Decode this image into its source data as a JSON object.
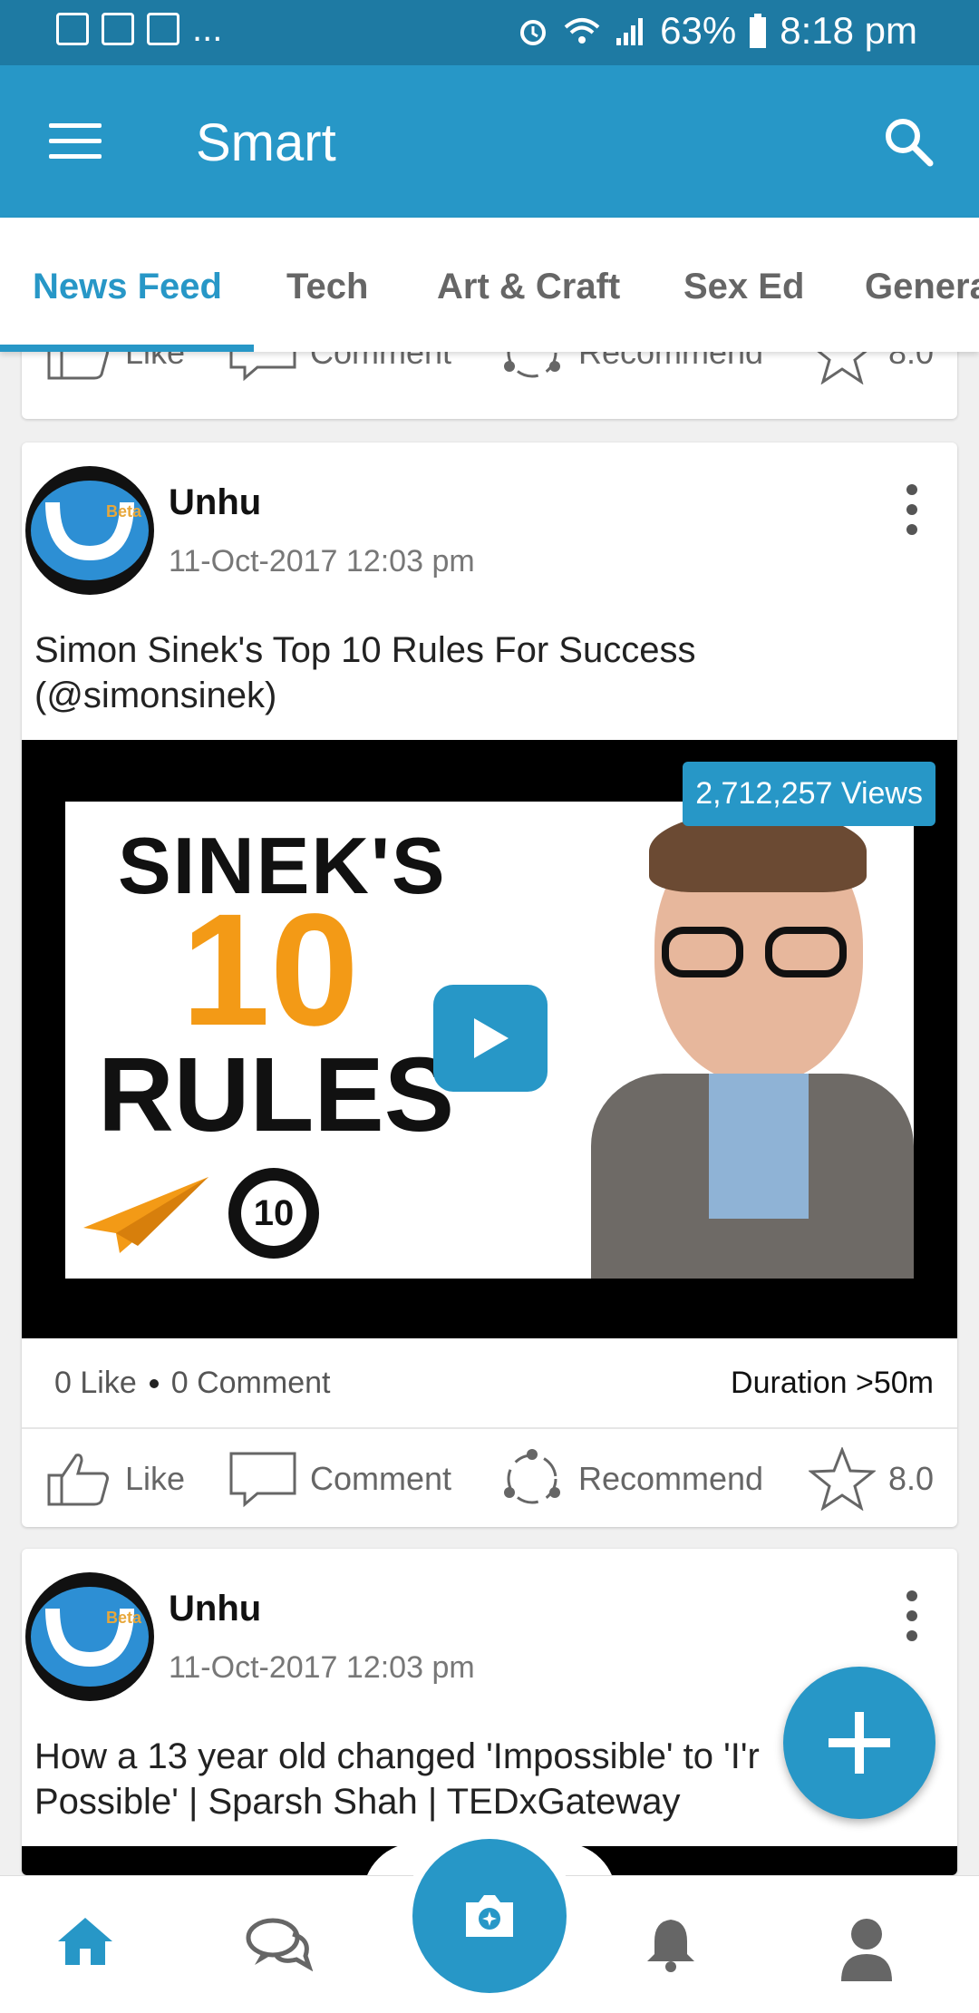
{
  "status_bar": {
    "dots": "...",
    "battery": "63%",
    "time": "8:18 pm"
  },
  "app_bar": {
    "title": "Smart"
  },
  "tabs": [
    {
      "label": "News Feed",
      "active": true
    },
    {
      "label": "Tech"
    },
    {
      "label": "Art & Craft"
    },
    {
      "label": "Sex Ed"
    },
    {
      "label": "Genera"
    }
  ],
  "actions": {
    "like": "Like",
    "comment": "Comment",
    "recommend": "Recommend",
    "rating": "8.0"
  },
  "posts": [
    {
      "author": "Unhu",
      "avatar_badge": "Beta",
      "date": "11-Oct-2017 12:03 pm",
      "title_line1": "Simon Sinek's Top 10 Rules For Success",
      "title_line2": "(@simonsinek)",
      "views": "2,712,257 Views",
      "thumb_text_1": "SINEK'S",
      "thumb_text_2": "10",
      "thumb_text_3": "RULES",
      "thumb_badge": "10",
      "likes": "0 Like",
      "comments": "0 Comment",
      "duration": "Duration >50m"
    },
    {
      "author": "Unhu",
      "avatar_badge": "Beta",
      "date": "11-Oct-2017 12:03 pm",
      "title_line1": "How a 13 year old changed 'Impossible' to 'I'r",
      "title_line2": "Possible' | Sparsh Shah | TEDxGateway"
    }
  ],
  "colors": {
    "primary": "#2797c7",
    "status_bar": "#1e7aa3",
    "accent_orange": "#f39a16"
  }
}
